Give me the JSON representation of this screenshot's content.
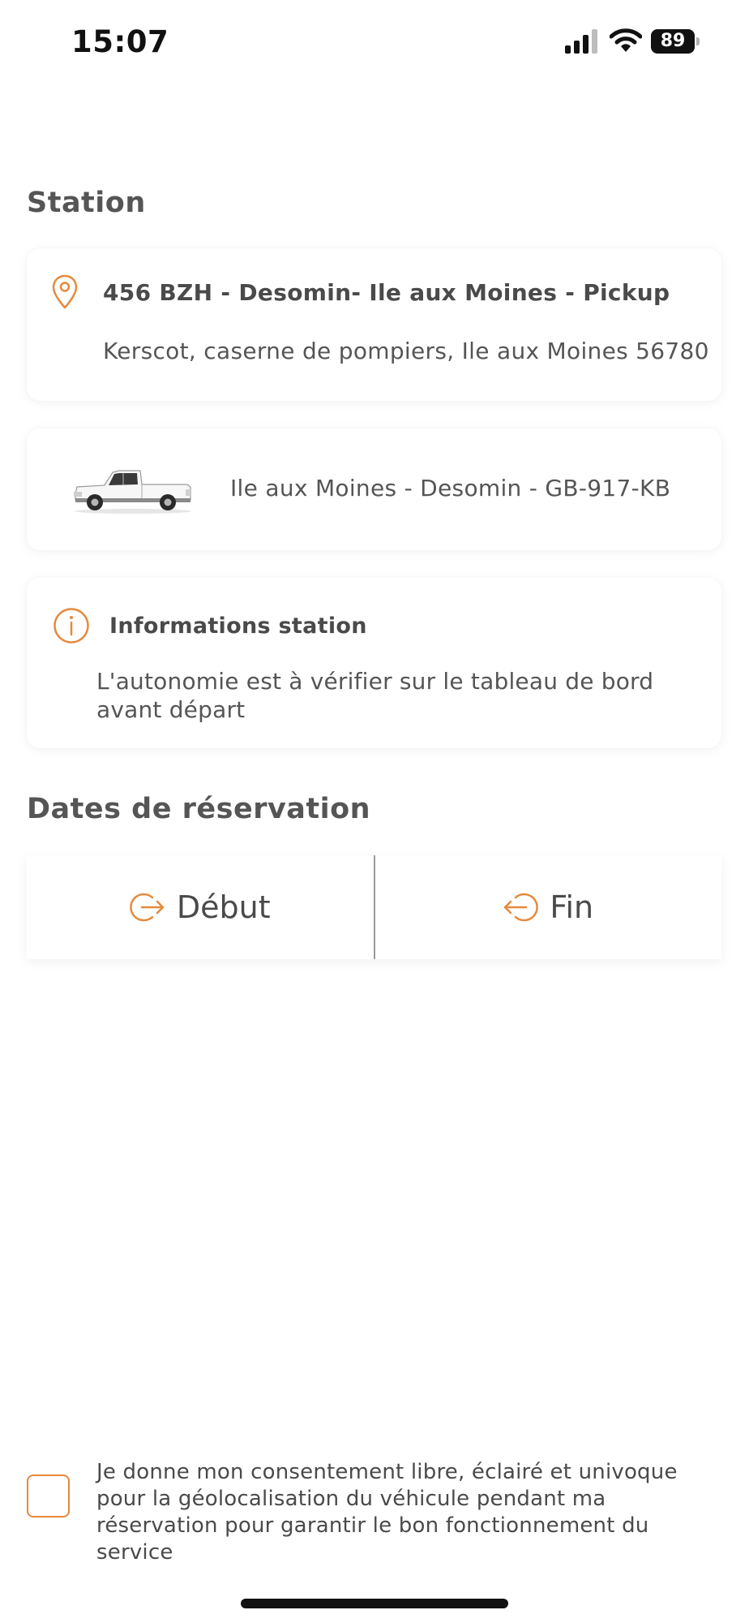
{
  "status_bar": {
    "time": "15:07",
    "battery_level": "89",
    "signal_icon": "cellular-signal-icon",
    "wifi_icon": "wifi-icon"
  },
  "station_section": {
    "title": "Station",
    "station_name": "456 BZH - Desomin- Ile aux Moines -  Pickup",
    "address": "Kerscot, caserne de pompiers, Ile aux Moines 56780",
    "icon": "location-pin-icon"
  },
  "vehicle": {
    "name": "Ile aux Moines - Desomin - GB-917-KB",
    "image": "white-pickup-truck"
  },
  "info": {
    "title": "Informations station",
    "text": "L'autonomie est à vérifier sur le tableau de bord avant départ",
    "icon": "info-circle-icon"
  },
  "dates_section": {
    "title": "Dates de réservation",
    "start_label": "Début",
    "end_label": "Fin"
  },
  "consent": {
    "checked": false,
    "text": "Je donne mon consentement libre, éclairé et univoque pour la géolocalisation du véhicule pendant ma réservation pour garantir le bon fonctionnement du service"
  },
  "colors": {
    "accent": "#e58a3c",
    "text": "#4a4a4a",
    "background": "#ffffff"
  }
}
